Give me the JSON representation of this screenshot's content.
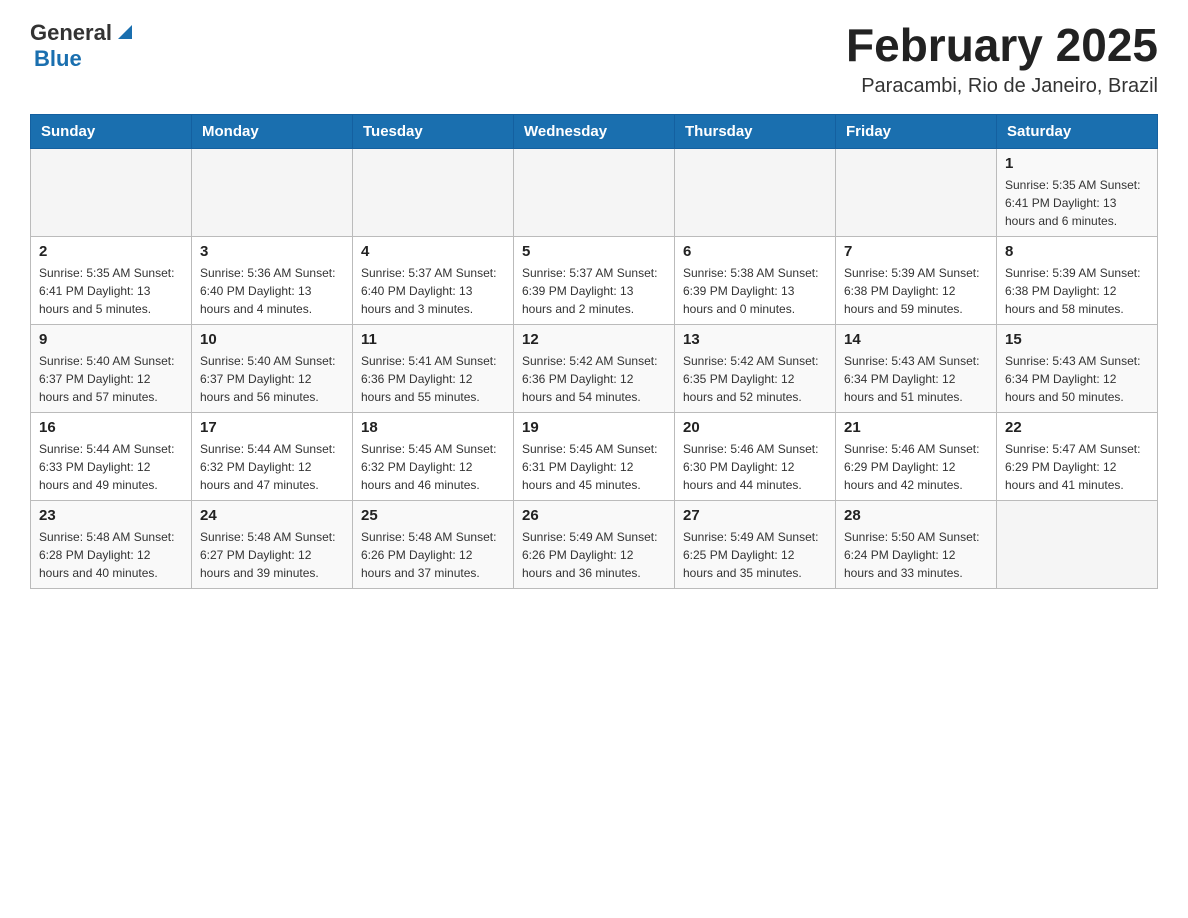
{
  "header": {
    "logo": {
      "text_general": "General",
      "text_blue": "Blue",
      "triangle": "▲"
    },
    "title": "February 2025",
    "location": "Paracambi, Rio de Janeiro, Brazil"
  },
  "calendar": {
    "days_of_week": [
      "Sunday",
      "Monday",
      "Tuesday",
      "Wednesday",
      "Thursday",
      "Friday",
      "Saturday"
    ],
    "weeks": [
      [
        {
          "day": "",
          "info": ""
        },
        {
          "day": "",
          "info": ""
        },
        {
          "day": "",
          "info": ""
        },
        {
          "day": "",
          "info": ""
        },
        {
          "day": "",
          "info": ""
        },
        {
          "day": "",
          "info": ""
        },
        {
          "day": "1",
          "info": "Sunrise: 5:35 AM\nSunset: 6:41 PM\nDaylight: 13 hours and 6 minutes."
        }
      ],
      [
        {
          "day": "2",
          "info": "Sunrise: 5:35 AM\nSunset: 6:41 PM\nDaylight: 13 hours and 5 minutes."
        },
        {
          "day": "3",
          "info": "Sunrise: 5:36 AM\nSunset: 6:40 PM\nDaylight: 13 hours and 4 minutes."
        },
        {
          "day": "4",
          "info": "Sunrise: 5:37 AM\nSunset: 6:40 PM\nDaylight: 13 hours and 3 minutes."
        },
        {
          "day": "5",
          "info": "Sunrise: 5:37 AM\nSunset: 6:39 PM\nDaylight: 13 hours and 2 minutes."
        },
        {
          "day": "6",
          "info": "Sunrise: 5:38 AM\nSunset: 6:39 PM\nDaylight: 13 hours and 0 minutes."
        },
        {
          "day": "7",
          "info": "Sunrise: 5:39 AM\nSunset: 6:38 PM\nDaylight: 12 hours and 59 minutes."
        },
        {
          "day": "8",
          "info": "Sunrise: 5:39 AM\nSunset: 6:38 PM\nDaylight: 12 hours and 58 minutes."
        }
      ],
      [
        {
          "day": "9",
          "info": "Sunrise: 5:40 AM\nSunset: 6:37 PM\nDaylight: 12 hours and 57 minutes."
        },
        {
          "day": "10",
          "info": "Sunrise: 5:40 AM\nSunset: 6:37 PM\nDaylight: 12 hours and 56 minutes."
        },
        {
          "day": "11",
          "info": "Sunrise: 5:41 AM\nSunset: 6:36 PM\nDaylight: 12 hours and 55 minutes."
        },
        {
          "day": "12",
          "info": "Sunrise: 5:42 AM\nSunset: 6:36 PM\nDaylight: 12 hours and 54 minutes."
        },
        {
          "day": "13",
          "info": "Sunrise: 5:42 AM\nSunset: 6:35 PM\nDaylight: 12 hours and 52 minutes."
        },
        {
          "day": "14",
          "info": "Sunrise: 5:43 AM\nSunset: 6:34 PM\nDaylight: 12 hours and 51 minutes."
        },
        {
          "day": "15",
          "info": "Sunrise: 5:43 AM\nSunset: 6:34 PM\nDaylight: 12 hours and 50 minutes."
        }
      ],
      [
        {
          "day": "16",
          "info": "Sunrise: 5:44 AM\nSunset: 6:33 PM\nDaylight: 12 hours and 49 minutes."
        },
        {
          "day": "17",
          "info": "Sunrise: 5:44 AM\nSunset: 6:32 PM\nDaylight: 12 hours and 47 minutes."
        },
        {
          "day": "18",
          "info": "Sunrise: 5:45 AM\nSunset: 6:32 PM\nDaylight: 12 hours and 46 minutes."
        },
        {
          "day": "19",
          "info": "Sunrise: 5:45 AM\nSunset: 6:31 PM\nDaylight: 12 hours and 45 minutes."
        },
        {
          "day": "20",
          "info": "Sunrise: 5:46 AM\nSunset: 6:30 PM\nDaylight: 12 hours and 44 minutes."
        },
        {
          "day": "21",
          "info": "Sunrise: 5:46 AM\nSunset: 6:29 PM\nDaylight: 12 hours and 42 minutes."
        },
        {
          "day": "22",
          "info": "Sunrise: 5:47 AM\nSunset: 6:29 PM\nDaylight: 12 hours and 41 minutes."
        }
      ],
      [
        {
          "day": "23",
          "info": "Sunrise: 5:48 AM\nSunset: 6:28 PM\nDaylight: 12 hours and 40 minutes."
        },
        {
          "day": "24",
          "info": "Sunrise: 5:48 AM\nSunset: 6:27 PM\nDaylight: 12 hours and 39 minutes."
        },
        {
          "day": "25",
          "info": "Sunrise: 5:48 AM\nSunset: 6:26 PM\nDaylight: 12 hours and 37 minutes."
        },
        {
          "day": "26",
          "info": "Sunrise: 5:49 AM\nSunset: 6:26 PM\nDaylight: 12 hours and 36 minutes."
        },
        {
          "day": "27",
          "info": "Sunrise: 5:49 AM\nSunset: 6:25 PM\nDaylight: 12 hours and 35 minutes."
        },
        {
          "day": "28",
          "info": "Sunrise: 5:50 AM\nSunset: 6:24 PM\nDaylight: 12 hours and 33 minutes."
        },
        {
          "day": "",
          "info": ""
        }
      ]
    ]
  }
}
